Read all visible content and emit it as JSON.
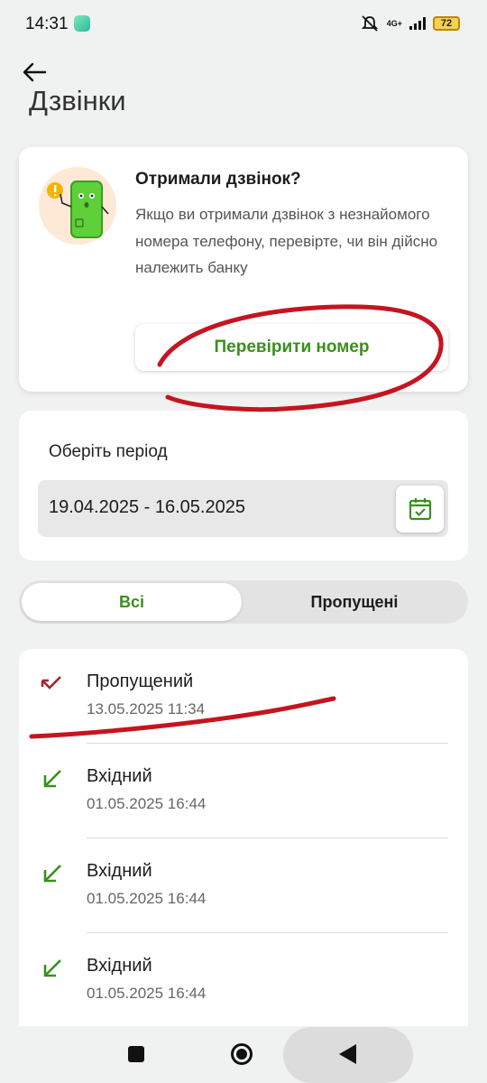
{
  "status_bar": {
    "time": "14:31",
    "network": "4G+",
    "battery": "72"
  },
  "header": {
    "title": "Дзвінки"
  },
  "promo": {
    "title": "Отримали дзвінок?",
    "text": "Якщо ви отримали дзвінок з незнайомого номера телефону, перевірте, чи він дійсно належить банку",
    "button_label": "Перевірити номер"
  },
  "period": {
    "label": "Оберіть період",
    "value": "19.04.2025 - 16.05.2025"
  },
  "tabs": [
    {
      "label": "Всі",
      "selected": true
    },
    {
      "label": "Пропущені",
      "selected": false
    }
  ],
  "calls": [
    {
      "type": "Пропущений",
      "datetime": "13.05.2025 11:34",
      "icon": "missed-call-icon",
      "color": "#a3262c"
    },
    {
      "type": "Вхідний",
      "datetime": "01.05.2025 16:44",
      "icon": "incoming-call-icon",
      "color": "#3a8f1d"
    },
    {
      "type": "Вхідний",
      "datetime": "01.05.2025 16:44",
      "icon": "incoming-call-icon",
      "color": "#3a8f1d"
    },
    {
      "type": "Вхідний",
      "datetime": "01.05.2025 16:44",
      "icon": "incoming-call-icon",
      "color": "#3a8f1d"
    }
  ],
  "colors": {
    "accent": "#3a8f1d",
    "missed": "#a3262c",
    "annotation": "#c41520"
  }
}
